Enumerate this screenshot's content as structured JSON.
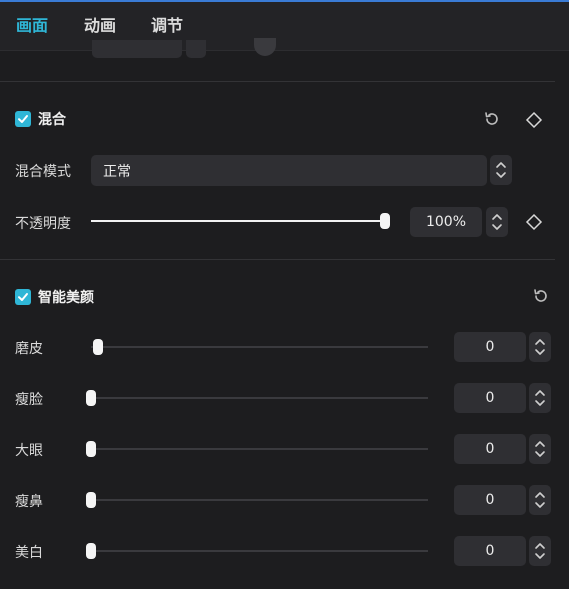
{
  "tabs": [
    {
      "label": "画面"
    },
    {
      "label": "动画"
    },
    {
      "label": "调节"
    }
  ],
  "blend": {
    "title": "混合",
    "checked": true,
    "mode_label": "混合模式",
    "mode_value": "正常",
    "opacity_label": "不透明度",
    "opacity_value": "100%",
    "opacity_fraction": 1.0
  },
  "beauty": {
    "title": "智能美颜",
    "checked": true,
    "items": [
      {
        "label": "磨皮",
        "value": "0"
      },
      {
        "label": "瘦脸",
        "value": "0"
      },
      {
        "label": "大眼",
        "value": "0"
      },
      {
        "label": "瘦鼻",
        "value": "0"
      },
      {
        "label": "美白",
        "value": "0"
      }
    ]
  },
  "colors": {
    "accent": "#2fb6d6",
    "background": "#1d1d1f",
    "control": "#2f2f33"
  }
}
